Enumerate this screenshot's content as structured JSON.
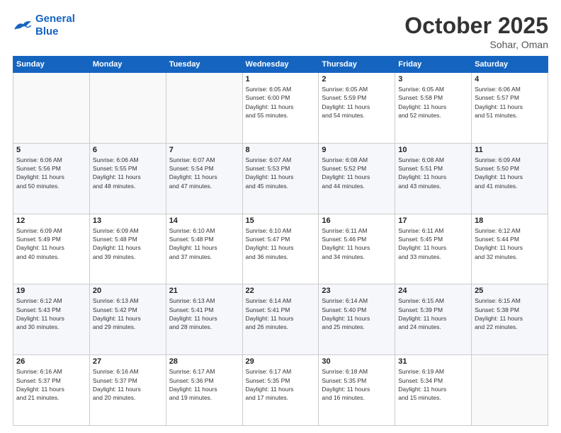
{
  "header": {
    "logo_line1": "General",
    "logo_line2": "Blue",
    "month": "October 2025",
    "location": "Sohar, Oman"
  },
  "weekdays": [
    "Sunday",
    "Monday",
    "Tuesday",
    "Wednesday",
    "Thursday",
    "Friday",
    "Saturday"
  ],
  "weeks": [
    [
      {
        "day": "",
        "info": ""
      },
      {
        "day": "",
        "info": ""
      },
      {
        "day": "",
        "info": ""
      },
      {
        "day": "1",
        "info": "Sunrise: 6:05 AM\nSunset: 6:00 PM\nDaylight: 11 hours\nand 55 minutes."
      },
      {
        "day": "2",
        "info": "Sunrise: 6:05 AM\nSunset: 5:59 PM\nDaylight: 11 hours\nand 54 minutes."
      },
      {
        "day": "3",
        "info": "Sunrise: 6:05 AM\nSunset: 5:58 PM\nDaylight: 11 hours\nand 52 minutes."
      },
      {
        "day": "4",
        "info": "Sunrise: 6:06 AM\nSunset: 5:57 PM\nDaylight: 11 hours\nand 51 minutes."
      }
    ],
    [
      {
        "day": "5",
        "info": "Sunrise: 6:06 AM\nSunset: 5:56 PM\nDaylight: 11 hours\nand 50 minutes."
      },
      {
        "day": "6",
        "info": "Sunrise: 6:06 AM\nSunset: 5:55 PM\nDaylight: 11 hours\nand 48 minutes."
      },
      {
        "day": "7",
        "info": "Sunrise: 6:07 AM\nSunset: 5:54 PM\nDaylight: 11 hours\nand 47 minutes."
      },
      {
        "day": "8",
        "info": "Sunrise: 6:07 AM\nSunset: 5:53 PM\nDaylight: 11 hours\nand 45 minutes."
      },
      {
        "day": "9",
        "info": "Sunrise: 6:08 AM\nSunset: 5:52 PM\nDaylight: 11 hours\nand 44 minutes."
      },
      {
        "day": "10",
        "info": "Sunrise: 6:08 AM\nSunset: 5:51 PM\nDaylight: 11 hours\nand 43 minutes."
      },
      {
        "day": "11",
        "info": "Sunrise: 6:09 AM\nSunset: 5:50 PM\nDaylight: 11 hours\nand 41 minutes."
      }
    ],
    [
      {
        "day": "12",
        "info": "Sunrise: 6:09 AM\nSunset: 5:49 PM\nDaylight: 11 hours\nand 40 minutes."
      },
      {
        "day": "13",
        "info": "Sunrise: 6:09 AM\nSunset: 5:48 PM\nDaylight: 11 hours\nand 39 minutes."
      },
      {
        "day": "14",
        "info": "Sunrise: 6:10 AM\nSunset: 5:48 PM\nDaylight: 11 hours\nand 37 minutes."
      },
      {
        "day": "15",
        "info": "Sunrise: 6:10 AM\nSunset: 5:47 PM\nDaylight: 11 hours\nand 36 minutes."
      },
      {
        "day": "16",
        "info": "Sunrise: 6:11 AM\nSunset: 5:46 PM\nDaylight: 11 hours\nand 34 minutes."
      },
      {
        "day": "17",
        "info": "Sunrise: 6:11 AM\nSunset: 5:45 PM\nDaylight: 11 hours\nand 33 minutes."
      },
      {
        "day": "18",
        "info": "Sunrise: 6:12 AM\nSunset: 5:44 PM\nDaylight: 11 hours\nand 32 minutes."
      }
    ],
    [
      {
        "day": "19",
        "info": "Sunrise: 6:12 AM\nSunset: 5:43 PM\nDaylight: 11 hours\nand 30 minutes."
      },
      {
        "day": "20",
        "info": "Sunrise: 6:13 AM\nSunset: 5:42 PM\nDaylight: 11 hours\nand 29 minutes."
      },
      {
        "day": "21",
        "info": "Sunrise: 6:13 AM\nSunset: 5:41 PM\nDaylight: 11 hours\nand 28 minutes."
      },
      {
        "day": "22",
        "info": "Sunrise: 6:14 AM\nSunset: 5:41 PM\nDaylight: 11 hours\nand 26 minutes."
      },
      {
        "day": "23",
        "info": "Sunrise: 6:14 AM\nSunset: 5:40 PM\nDaylight: 11 hours\nand 25 minutes."
      },
      {
        "day": "24",
        "info": "Sunrise: 6:15 AM\nSunset: 5:39 PM\nDaylight: 11 hours\nand 24 minutes."
      },
      {
        "day": "25",
        "info": "Sunrise: 6:15 AM\nSunset: 5:38 PM\nDaylight: 11 hours\nand 22 minutes."
      }
    ],
    [
      {
        "day": "26",
        "info": "Sunrise: 6:16 AM\nSunset: 5:37 PM\nDaylight: 11 hours\nand 21 minutes."
      },
      {
        "day": "27",
        "info": "Sunrise: 6:16 AM\nSunset: 5:37 PM\nDaylight: 11 hours\nand 20 minutes."
      },
      {
        "day": "28",
        "info": "Sunrise: 6:17 AM\nSunset: 5:36 PM\nDaylight: 11 hours\nand 19 minutes."
      },
      {
        "day": "29",
        "info": "Sunrise: 6:17 AM\nSunset: 5:35 PM\nDaylight: 11 hours\nand 17 minutes."
      },
      {
        "day": "30",
        "info": "Sunrise: 6:18 AM\nSunset: 5:35 PM\nDaylight: 11 hours\nand 16 minutes."
      },
      {
        "day": "31",
        "info": "Sunrise: 6:19 AM\nSunset: 5:34 PM\nDaylight: 11 hours\nand 15 minutes."
      },
      {
        "day": "",
        "info": ""
      }
    ]
  ]
}
